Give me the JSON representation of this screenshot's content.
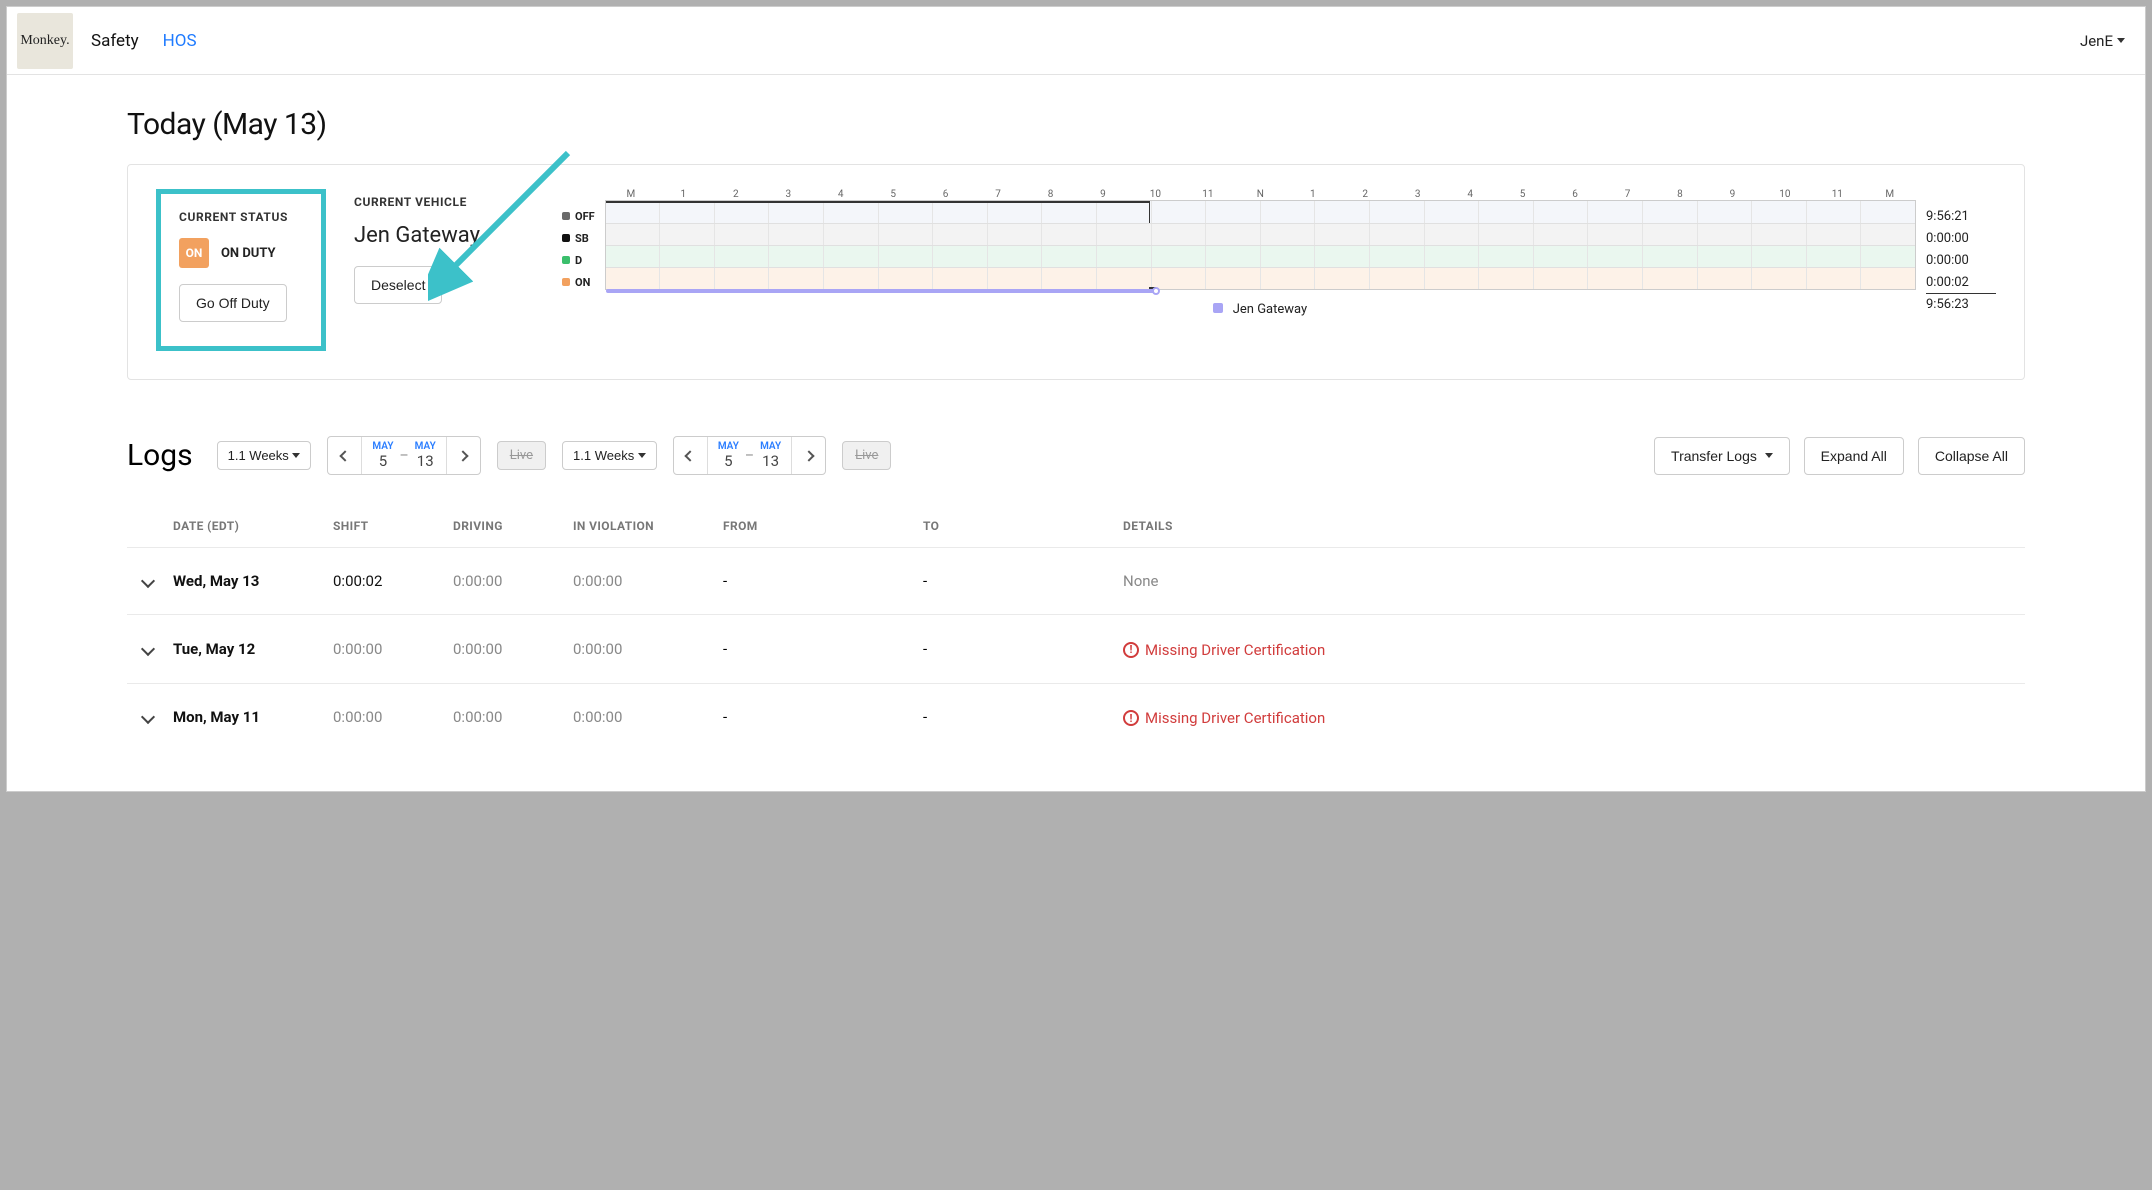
{
  "logo_text": "Monkey.",
  "nav": {
    "safety": "Safety",
    "hos": "HOS"
  },
  "user": "JenE",
  "page_title": "Today (May 13)",
  "status": {
    "section_label": "CURRENT STATUS",
    "badge": "ON",
    "text": "ON DUTY",
    "button": "Go Off Duty"
  },
  "vehicle": {
    "section_label": "CURRENT VEHICLE",
    "name": "Jen Gateway",
    "button": "Deselect"
  },
  "timeline": {
    "hours": [
      "M",
      "1",
      "2",
      "3",
      "4",
      "5",
      "6",
      "7",
      "8",
      "9",
      "10",
      "11",
      "N",
      "1",
      "2",
      "3",
      "4",
      "5",
      "6",
      "7",
      "8",
      "9",
      "10",
      "11",
      "M"
    ],
    "rows": {
      "off": "OFF",
      "sb": "SB",
      "d": "D",
      "on": "ON"
    },
    "side_times": {
      "off": "9:56:21",
      "sb": "0:00:00",
      "d": "0:00:00",
      "on": "0:00:02",
      "total": "9:56:23"
    },
    "legend_vehicle": "Jen Gateway"
  },
  "logs": {
    "title": "Logs",
    "weeks_label": "1.1 Weeks",
    "range": {
      "from_mon": "MAY",
      "from_day": "5",
      "to_mon": "MAY",
      "to_day": "13"
    },
    "live": "Live",
    "transfer": "Transfer Logs",
    "expand": "Expand All",
    "collapse": "Collapse All",
    "headers": {
      "date": "DATE (EDT)",
      "shift": "SHIFT",
      "driving": "DRIVING",
      "violation": "IN VIOLATION",
      "from": "FROM",
      "to": "TO",
      "details": "DETAILS"
    },
    "rows": [
      {
        "date": "Wed, May 13",
        "shift": "0:00:02",
        "shift_muted": false,
        "driving": "0:00:00",
        "violation": "0:00:00",
        "from": "-",
        "to": "-",
        "details": "None",
        "warn": false
      },
      {
        "date": "Tue, May 12",
        "shift": "0:00:00",
        "shift_muted": true,
        "driving": "0:00:00",
        "violation": "0:00:00",
        "from": "-",
        "to": "-",
        "details": "Missing Driver Certification",
        "warn": true
      },
      {
        "date": "Mon, May 11",
        "shift": "0:00:00",
        "shift_muted": true,
        "driving": "0:00:00",
        "violation": "0:00:00",
        "from": "-",
        "to": "-",
        "details": "Missing Driver Certification",
        "warn": true
      }
    ]
  }
}
